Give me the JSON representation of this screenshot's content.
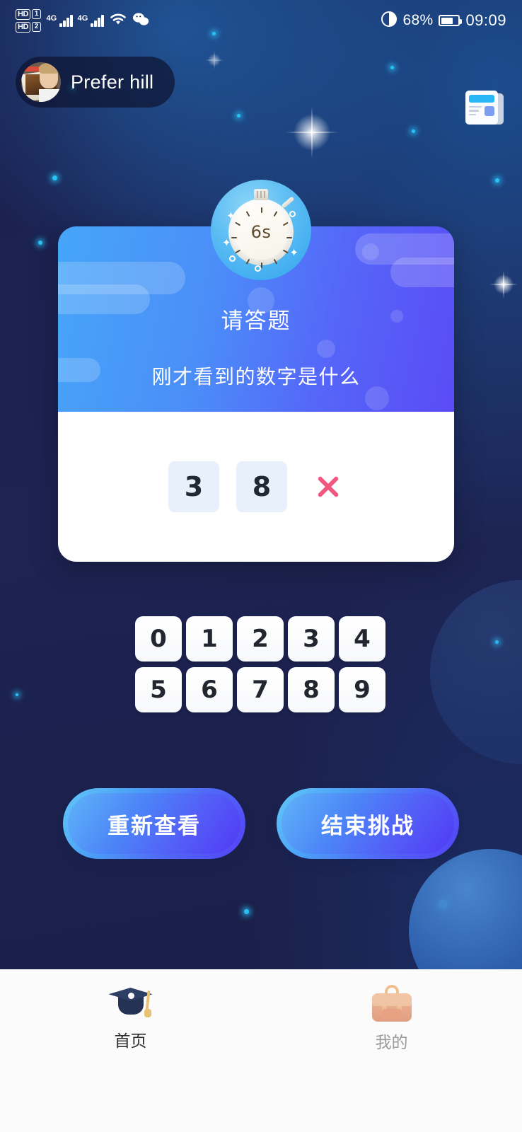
{
  "status_bar": {
    "hd1_label": "HD",
    "sim1_label": "1",
    "hd2_label": "HD",
    "sim2_label": "2",
    "network1": "4G",
    "network2": "4G",
    "wifi_icon": "wifi-icon",
    "wechat_icon": "wechat-icon",
    "eye_icon": "eye-protection-icon",
    "battery_percent": "68%",
    "time": "09:09"
  },
  "header": {
    "username": "Prefer hill",
    "avatar_name": "user-avatar",
    "rules_icon": "rules-document-icon"
  },
  "timer": {
    "value": "6s",
    "icon": "stopwatch-icon"
  },
  "quiz_card": {
    "title": "请答题",
    "subtitle": "刚才看到的数字是什么",
    "entered_digits": [
      "3",
      "8"
    ],
    "clear_icon": "clear-cross-icon"
  },
  "keypad": {
    "rows": [
      [
        "0",
        "1",
        "2",
        "3",
        "4"
      ],
      [
        "5",
        "6",
        "7",
        "8",
        "9"
      ]
    ]
  },
  "actions": {
    "review_label": "重新查看",
    "end_label": "结束挑战"
  },
  "tabbar": {
    "tabs": [
      {
        "label": "首页",
        "icon": "graduation-cap-icon",
        "active": true
      },
      {
        "label": "我的",
        "icon": "backpack-icon",
        "active": false
      }
    ]
  },
  "colors": {
    "background": "#1a2150",
    "card_gradient_start": "#46a6f8",
    "card_gradient_end": "#5a4bf6",
    "accent_pink": "#f2577f",
    "key_white": "#ffffff",
    "tile_blue": "#e8f0fb",
    "timer_blue": "#2fa5ef"
  }
}
